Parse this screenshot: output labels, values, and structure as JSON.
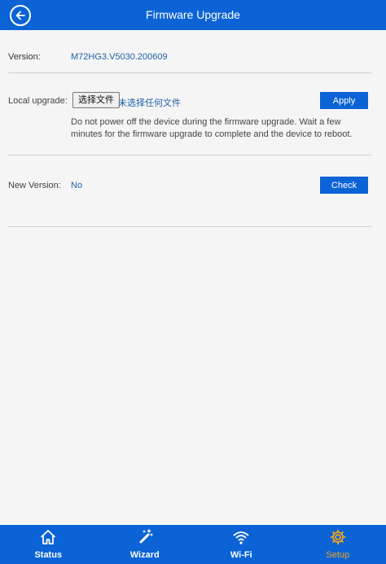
{
  "header": {
    "title": "Firmware Upgrade"
  },
  "version": {
    "label": "Version:",
    "value": "M72HG3.V5030.200609"
  },
  "local_upgrade": {
    "label": "Local upgrade:",
    "choose_file_label": "选择文件",
    "file_status": "未选择任何文件",
    "apply_label": "Apply",
    "notice": "Do not power off the device during the firmware upgrade. Wait a few minutes for the firmware upgrade to complete and the device to reboot."
  },
  "new_version": {
    "label": "New Version:",
    "value": "No",
    "check_label": "Check"
  },
  "tabs": [
    {
      "label": "Status",
      "icon": "home-icon"
    },
    {
      "label": "Wizard",
      "icon": "wand-icon"
    },
    {
      "label": "Wi-Fi",
      "icon": "wifi-icon"
    },
    {
      "label": "Setup",
      "icon": "gear-icon",
      "active": true
    }
  ],
  "colors": {
    "primary": "#0b63d6",
    "active_tab": "#f3a31b",
    "link_text": "#1f5ea8",
    "background": "#f5f5f5"
  }
}
